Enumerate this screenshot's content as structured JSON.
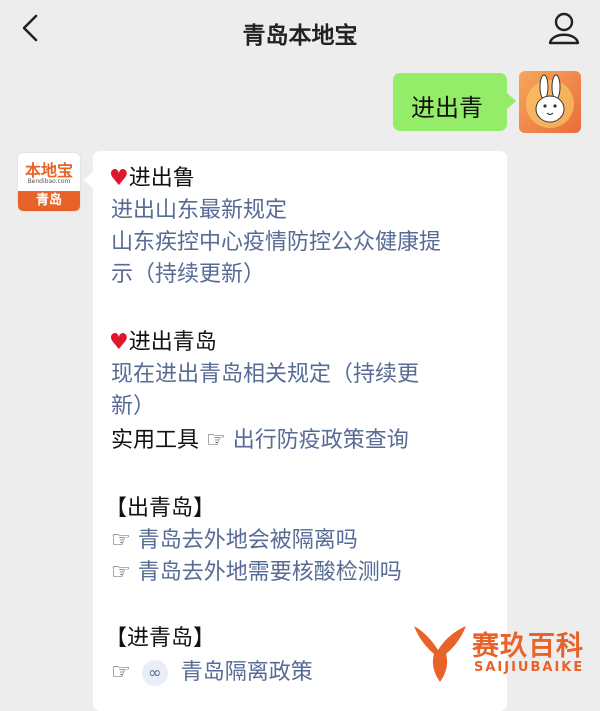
{
  "header": {
    "title": "青岛本地宝",
    "back_icon": "chevron-left-icon",
    "profile_icon": "person-icon"
  },
  "outgoing": {
    "text": "进出青"
  },
  "bot_avatar": {
    "logo_text": "本地宝",
    "url_text": "Bendibao.com",
    "city_text": "青岛"
  },
  "reply": {
    "section1": {
      "heading": "进出鲁",
      "link1": "进出山东最新规定",
      "link2_line1": "山东疾控中心疫情防控公众健康提",
      "link2_line2": "示（持续更新）"
    },
    "section2": {
      "heading": "进出青岛",
      "link1_line1": "现在进出青岛相关规定（持续更",
      "link1_line2": "新）",
      "tool_label": "实用工具",
      "tool_link": "出行防疫政策查询"
    },
    "section3": {
      "heading": "【出青岛】",
      "link1": "青岛去外地会被隔离吗",
      "link2": "青岛去外地需要核酸检测吗"
    },
    "section4": {
      "heading": "【进青岛】",
      "link1": "青岛隔离政策"
    }
  },
  "watermark": {
    "brand": "赛玖百科",
    "sub": "SAIJIUBAIKE"
  },
  "colors": {
    "link": "#576b95",
    "sent_bubble": "#95ec69",
    "heart": "#e0162b",
    "brand_orange": "#e8632a"
  }
}
